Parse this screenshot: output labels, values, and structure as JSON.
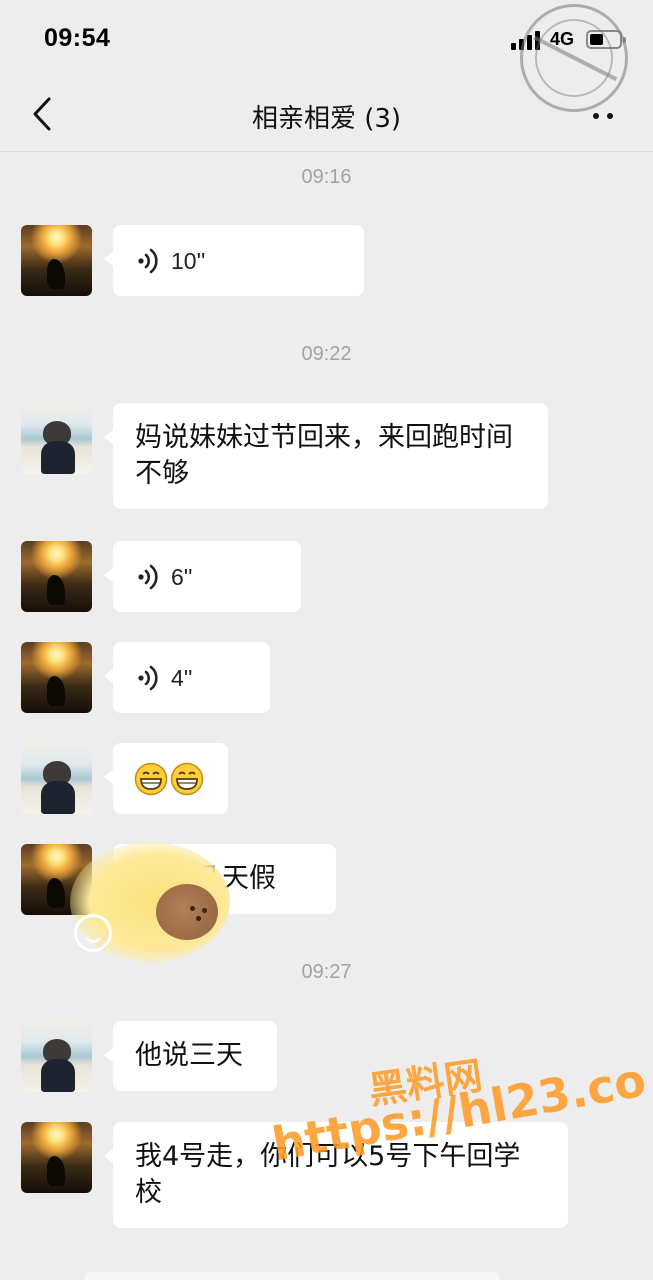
{
  "status_bar": {
    "time": "09:54",
    "network": "4G",
    "battery_level": 0.45
  },
  "nav": {
    "title": "相亲相爱 (3)",
    "back_icon": "chevron-left-icon",
    "more_icon": "more-dots-icon"
  },
  "watermark_seal": {
    "text": "heiliao.com 黑料社区"
  },
  "chat": {
    "dividers": [
      "09:16",
      "09:22",
      "09:27"
    ],
    "messages": [
      {
        "sender": "sunset-avatar",
        "type": "voice",
        "duration": "10''"
      },
      {
        "sender": "girl-avatar",
        "type": "text",
        "text": "妈说妹妹过节回来，来回跑时间不够"
      },
      {
        "sender": "sunset-avatar",
        "type": "voice",
        "duration": "6''"
      },
      {
        "sender": "sunset-avatar",
        "type": "voice",
        "duration": "4''"
      },
      {
        "sender": "girl-avatar",
        "type": "emoji",
        "emoji": "😄😄"
      },
      {
        "sender": "sunset-avatar",
        "type": "text",
        "text": "是几天假"
      },
      {
        "sender": "girl-avatar",
        "type": "text",
        "text": "他说三天"
      },
      {
        "sender": "sunset-avatar",
        "type": "text",
        "text": "我4号走，你们可以5号下午回学校"
      }
    ]
  },
  "watermark": {
    "brand": "黑料网",
    "url": "https://hl23.co"
  },
  "colors": {
    "background": "#ededed",
    "bubble": "#ffffff",
    "timestamp": "#a3a3a3",
    "watermark": "#ff9b28"
  }
}
